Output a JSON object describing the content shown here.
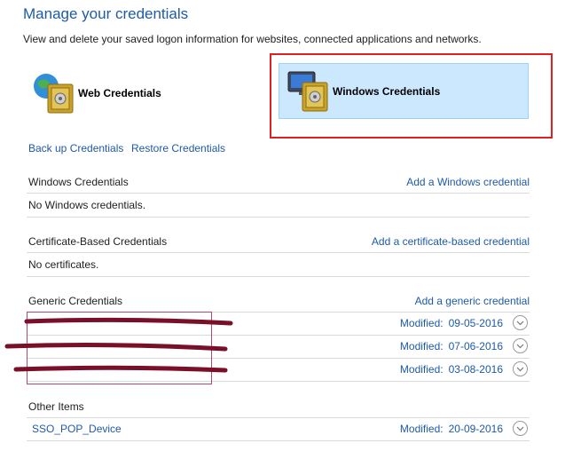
{
  "header": {
    "title": "Manage your credentials",
    "subtitle": "View and delete your saved logon information for websites, connected applications and networks."
  },
  "tiles": {
    "web": {
      "label": "Web Credentials",
      "icon": "globe-vault-icon"
    },
    "windows": {
      "label": "Windows Credentials",
      "icon": "monitor-vault-icon",
      "selected": true
    }
  },
  "actions": {
    "backup": "Back up Credentials",
    "restore": "Restore Credentials"
  },
  "sections": {
    "windows": {
      "title": "Windows Credentials",
      "add": "Add a Windows credential",
      "empty": "No Windows credentials."
    },
    "certificate": {
      "title": "Certificate-Based Credentials",
      "add": "Add a certificate-based credential",
      "empty": "No certificates."
    },
    "generic": {
      "title": "Generic Credentials",
      "add": "Add a generic credential",
      "items": [
        {
          "name": "",
          "modified_label": "Modified:",
          "date": "09-05-2016",
          "redacted": true
        },
        {
          "name": "",
          "modified_label": "Modified:",
          "date": "07-06-2016",
          "redacted": true
        },
        {
          "name": "",
          "modified_label": "Modified:",
          "date": "03-08-2016",
          "redacted": true
        }
      ]
    },
    "other": {
      "title": "Other Items",
      "items": [
        {
          "name": "SSO_POP_Device",
          "modified_label": "Modified:",
          "date": "20-09-2016"
        }
      ]
    }
  },
  "colors": {
    "link": "#1e5aa8",
    "selected_tile": "#cce8ff",
    "annotation": "#e02020",
    "redaction": "#7a0f2a"
  }
}
